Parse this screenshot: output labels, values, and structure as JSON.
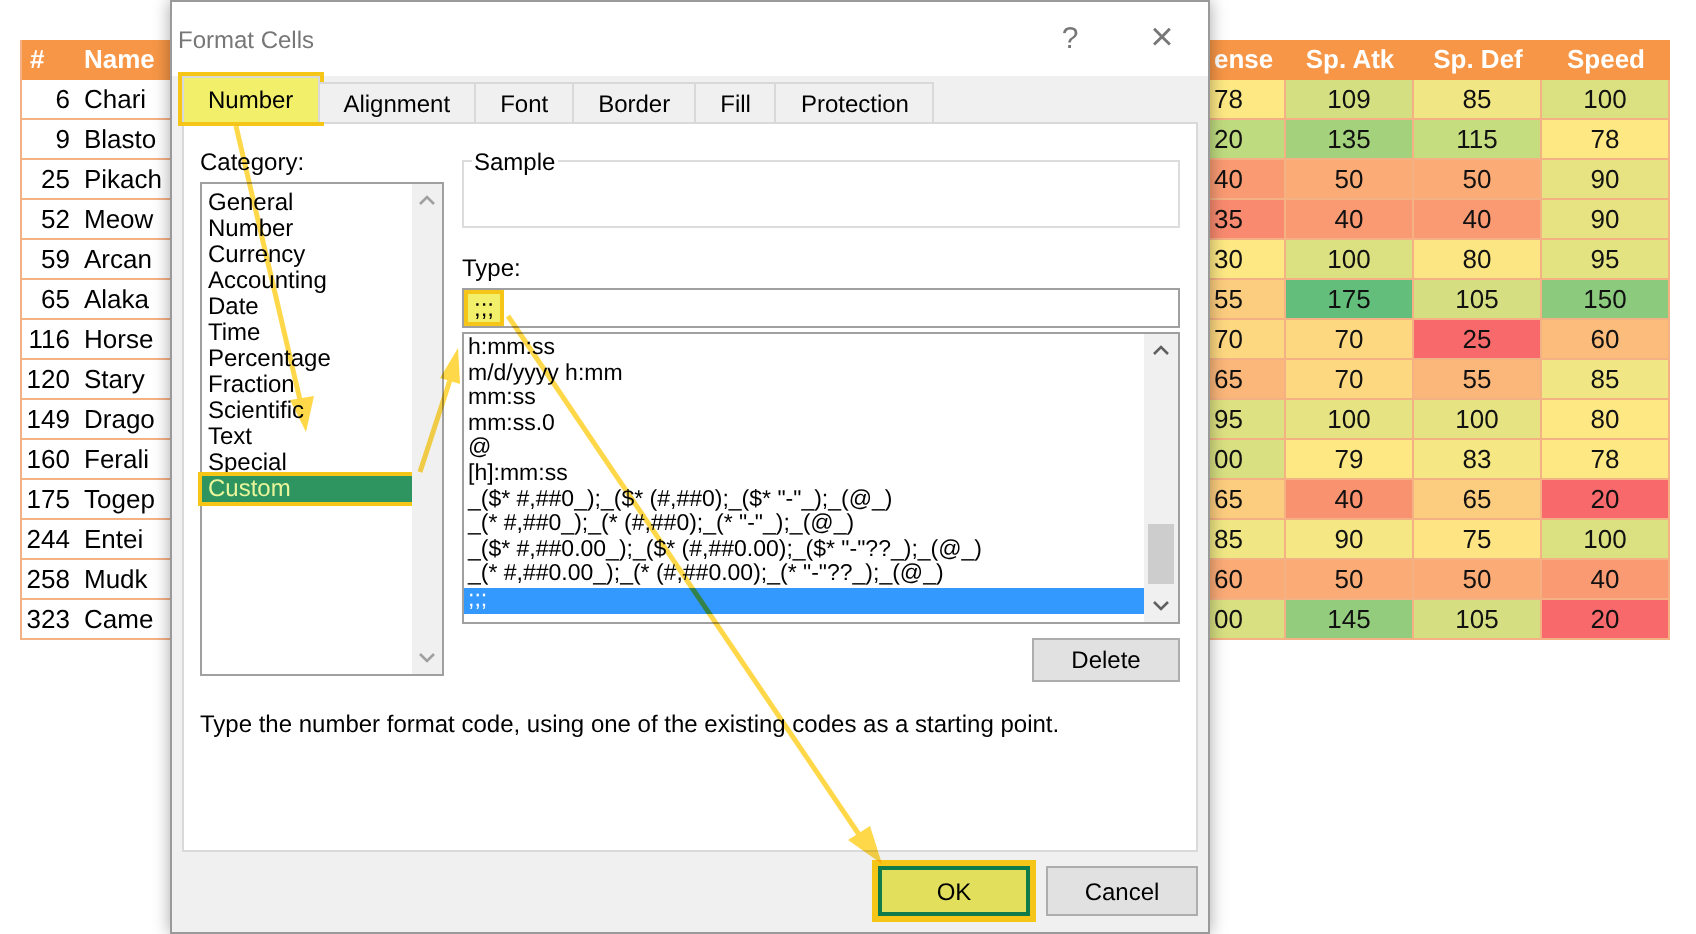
{
  "sheet": {
    "columns": [
      "#",
      "Name",
      "ense",
      "Sp. Atk",
      "Sp. Def",
      "Speed"
    ],
    "rows": [
      {
        "num": "6",
        "name": "Chari",
        "stats": [
          {
            "text": "78",
            "color": "#fde884"
          },
          {
            "text": "109",
            "color": "#d3df80"
          },
          {
            "text": "85",
            "color": "#f0e784"
          },
          {
            "text": "100",
            "color": "#dbe081"
          }
        ]
      },
      {
        "num": "9",
        "name": "Blasto",
        "stats": [
          {
            "text": "20",
            "color": "#bfdb7f"
          },
          {
            "text": "135",
            "color": "#a3d17c"
          },
          {
            "text": "115",
            "color": "#c5dc7f"
          },
          {
            "text": "78",
            "color": "#fde884"
          }
        ]
      },
      {
        "num": "25",
        "name": "Pikach",
        "stats": [
          {
            "text": "40",
            "color": "#f99a72"
          },
          {
            "text": "50",
            "color": "#fbab76"
          },
          {
            "text": "50",
            "color": "#fbab76"
          },
          {
            "text": "90",
            "color": "#e8e382"
          }
        ]
      },
      {
        "num": "52",
        "name": "Meow",
        "stats": [
          {
            "text": "35",
            "color": "#f98a6f"
          },
          {
            "text": "40",
            "color": "#f99a72"
          },
          {
            "text": "40",
            "color": "#f99a72"
          },
          {
            "text": "90",
            "color": "#e8e382"
          }
        ]
      },
      {
        "num": "59",
        "name": "Arcan",
        "stats": [
          {
            "text": "30",
            "color": "#fde884"
          },
          {
            "text": "100",
            "color": "#dbe081"
          },
          {
            "text": "80",
            "color": "#fbe683"
          },
          {
            "text": "95",
            "color": "#e4e382"
          }
        ]
      },
      {
        "num": "65",
        "name": "Alaka",
        "stats": [
          {
            "text": "55",
            "color": "#fccd7e"
          },
          {
            "text": "175",
            "color": "#63be7b"
          },
          {
            "text": "105",
            "color": "#d5df81"
          },
          {
            "text": "150",
            "color": "#8cca7e"
          }
        ]
      },
      {
        "num": "116",
        "name": "Horse",
        "stats": [
          {
            "text": "70",
            "color": "#fed880"
          },
          {
            "text": "70",
            "color": "#fed880"
          },
          {
            "text": "25",
            "color": "#f8696b"
          },
          {
            "text": "60",
            "color": "#fcbc7b"
          }
        ]
      },
      {
        "num": "120",
        "name": "Stary",
        "stats": [
          {
            "text": "65",
            "color": "#fbb679"
          },
          {
            "text": "70",
            "color": "#fed880"
          },
          {
            "text": "55",
            "color": "#fbb679"
          },
          {
            "text": "85",
            "color": "#f0e784"
          }
        ]
      },
      {
        "num": "149",
        "name": "Drago",
        "stats": [
          {
            "text": "95",
            "color": "#dde181"
          },
          {
            "text": "100",
            "color": "#e6e382"
          },
          {
            "text": "100",
            "color": "#e6e382"
          },
          {
            "text": "80",
            "color": "#fde884"
          }
        ]
      },
      {
        "num": "160",
        "name": "Ferali",
        "stats": [
          {
            "text": "00",
            "color": "#d8e081"
          },
          {
            "text": "79",
            "color": "#fee883"
          },
          {
            "text": "83",
            "color": "#f5e784"
          },
          {
            "text": "78",
            "color": "#fee883"
          }
        ]
      },
      {
        "num": "175",
        "name": "Togep",
        "stats": [
          {
            "text": "65",
            "color": "#fccd7e"
          },
          {
            "text": "40",
            "color": "#f8926f"
          },
          {
            "text": "65",
            "color": "#fccd7e"
          },
          {
            "text": "20",
            "color": "#f8696b"
          }
        ]
      },
      {
        "num": "244",
        "name": "Entei",
        "stats": [
          {
            "text": "85",
            "color": "#f0e784"
          },
          {
            "text": "90",
            "color": "#f5e784"
          },
          {
            "text": "75",
            "color": "#fee483"
          },
          {
            "text": "100",
            "color": "#dbe081"
          }
        ]
      },
      {
        "num": "258",
        "name": "Mudk",
        "stats": [
          {
            "text": "60",
            "color": "#fbab76"
          },
          {
            "text": "50",
            "color": "#fbab76"
          },
          {
            "text": "50",
            "color": "#fbab76"
          },
          {
            "text": "40",
            "color": "#f99a72"
          }
        ]
      },
      {
        "num": "323",
        "name": "Came",
        "stats": [
          {
            "text": "00",
            "color": "#d8e081"
          },
          {
            "text": "145",
            "color": "#93cc7d"
          },
          {
            "text": "105",
            "color": "#d5df81"
          },
          {
            "text": "20",
            "color": "#f8696b"
          }
        ]
      }
    ]
  },
  "dialog": {
    "title": "Format Cells",
    "help": "?",
    "close": "×",
    "tabs": [
      {
        "label": "Number",
        "selected": true,
        "highlighted": true
      },
      {
        "label": "Alignment",
        "selected": false,
        "highlighted": false
      },
      {
        "label": "Font",
        "selected": false,
        "highlighted": false
      },
      {
        "label": "Border",
        "selected": false,
        "highlighted": false
      },
      {
        "label": "Fill",
        "selected": false,
        "highlighted": false
      },
      {
        "label": "Protection",
        "selected": false,
        "highlighted": false
      }
    ],
    "category_label": "Category:",
    "categories": [
      {
        "label": "General",
        "selected": false,
        "highlighted": false
      },
      {
        "label": "Number",
        "selected": false,
        "highlighted": false
      },
      {
        "label": "Currency",
        "selected": false,
        "highlighted": false
      },
      {
        "label": "Accounting",
        "selected": false,
        "highlighted": false
      },
      {
        "label": "Date",
        "selected": false,
        "highlighted": false
      },
      {
        "label": "Time",
        "selected": false,
        "highlighted": false
      },
      {
        "label": "Percentage",
        "selected": false,
        "highlighted": false
      },
      {
        "label": "Fraction",
        "selected": false,
        "highlighted": false
      },
      {
        "label": "Scientific",
        "selected": false,
        "highlighted": false
      },
      {
        "label": "Text",
        "selected": false,
        "highlighted": false
      },
      {
        "label": "Special",
        "selected": false,
        "highlighted": false
      },
      {
        "label": "Custom",
        "selected": true,
        "highlighted": true
      }
    ],
    "sample_label": "Sample",
    "type_label": "Type:",
    "type_field": {
      "value": ";;;",
      "highlighted": true
    },
    "formats": [
      {
        "label": "h:mm:ss",
        "selected": false
      },
      {
        "label": "m/d/yyyy h:mm",
        "selected": false
      },
      {
        "label": "mm:ss",
        "selected": false
      },
      {
        "label": "mm:ss.0",
        "selected": false
      },
      {
        "label": "@",
        "selected": false
      },
      {
        "label": "[h]:mm:ss",
        "selected": false
      },
      {
        "label": "_($* #,##0_);_($* (#,##0);_($* \"-\"_);_(@_)",
        "selected": false
      },
      {
        "label": "_(* #,##0_);_(* (#,##0);_(* \"-\"_);_(@_)",
        "selected": false
      },
      {
        "label": "_($* #,##0.00_);_($* (#,##0.00);_($* \"-\"??_);_(@_)",
        "selected": false
      },
      {
        "label": "_(* #,##0.00_);_(* (#,##0.00);_(* \"-\"??_);_(@_)",
        "selected": false
      },
      {
        "label": ";;;",
        "selected": true
      }
    ],
    "delete_button": "Delete",
    "description": "Type the number format code, using one of the existing codes as a starting point.",
    "buttons": [
      {
        "label": "OK",
        "highlighted": true
      },
      {
        "label": "Cancel",
        "highlighted": false
      }
    ]
  }
}
